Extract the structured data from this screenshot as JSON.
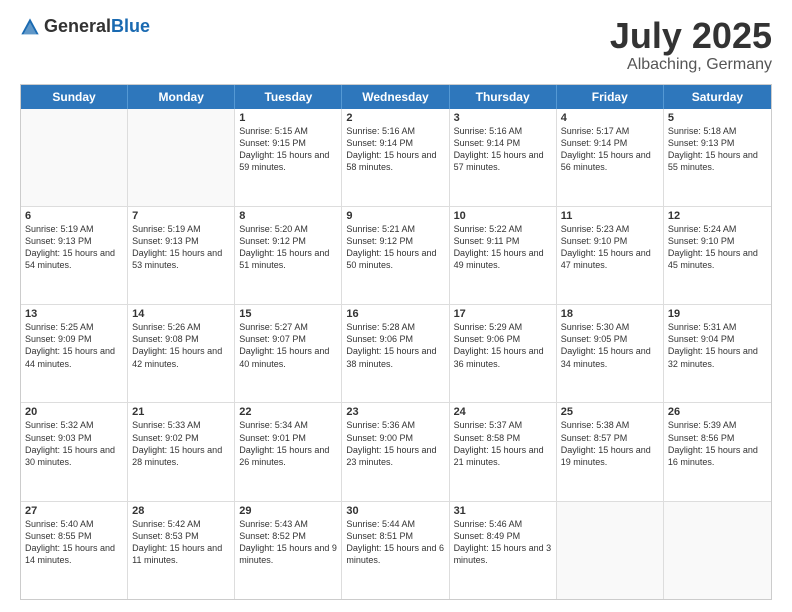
{
  "header": {
    "logo_general": "General",
    "logo_blue": "Blue",
    "month": "July 2025",
    "location": "Albaching, Germany"
  },
  "days_of_week": [
    "Sunday",
    "Monday",
    "Tuesday",
    "Wednesday",
    "Thursday",
    "Friday",
    "Saturday"
  ],
  "weeks": [
    [
      {
        "day": "",
        "sunrise": "",
        "sunset": "",
        "daylight": ""
      },
      {
        "day": "",
        "sunrise": "",
        "sunset": "",
        "daylight": ""
      },
      {
        "day": "1",
        "sunrise": "Sunrise: 5:15 AM",
        "sunset": "Sunset: 9:15 PM",
        "daylight": "Daylight: 15 hours and 59 minutes."
      },
      {
        "day": "2",
        "sunrise": "Sunrise: 5:16 AM",
        "sunset": "Sunset: 9:14 PM",
        "daylight": "Daylight: 15 hours and 58 minutes."
      },
      {
        "day": "3",
        "sunrise": "Sunrise: 5:16 AM",
        "sunset": "Sunset: 9:14 PM",
        "daylight": "Daylight: 15 hours and 57 minutes."
      },
      {
        "day": "4",
        "sunrise": "Sunrise: 5:17 AM",
        "sunset": "Sunset: 9:14 PM",
        "daylight": "Daylight: 15 hours and 56 minutes."
      },
      {
        "day": "5",
        "sunrise": "Sunrise: 5:18 AM",
        "sunset": "Sunset: 9:13 PM",
        "daylight": "Daylight: 15 hours and 55 minutes."
      }
    ],
    [
      {
        "day": "6",
        "sunrise": "Sunrise: 5:19 AM",
        "sunset": "Sunset: 9:13 PM",
        "daylight": "Daylight: 15 hours and 54 minutes."
      },
      {
        "day": "7",
        "sunrise": "Sunrise: 5:19 AM",
        "sunset": "Sunset: 9:13 PM",
        "daylight": "Daylight: 15 hours and 53 minutes."
      },
      {
        "day": "8",
        "sunrise": "Sunrise: 5:20 AM",
        "sunset": "Sunset: 9:12 PM",
        "daylight": "Daylight: 15 hours and 51 minutes."
      },
      {
        "day": "9",
        "sunrise": "Sunrise: 5:21 AM",
        "sunset": "Sunset: 9:12 PM",
        "daylight": "Daylight: 15 hours and 50 minutes."
      },
      {
        "day": "10",
        "sunrise": "Sunrise: 5:22 AM",
        "sunset": "Sunset: 9:11 PM",
        "daylight": "Daylight: 15 hours and 49 minutes."
      },
      {
        "day": "11",
        "sunrise": "Sunrise: 5:23 AM",
        "sunset": "Sunset: 9:10 PM",
        "daylight": "Daylight: 15 hours and 47 minutes."
      },
      {
        "day": "12",
        "sunrise": "Sunrise: 5:24 AM",
        "sunset": "Sunset: 9:10 PM",
        "daylight": "Daylight: 15 hours and 45 minutes."
      }
    ],
    [
      {
        "day": "13",
        "sunrise": "Sunrise: 5:25 AM",
        "sunset": "Sunset: 9:09 PM",
        "daylight": "Daylight: 15 hours and 44 minutes."
      },
      {
        "day": "14",
        "sunrise": "Sunrise: 5:26 AM",
        "sunset": "Sunset: 9:08 PM",
        "daylight": "Daylight: 15 hours and 42 minutes."
      },
      {
        "day": "15",
        "sunrise": "Sunrise: 5:27 AM",
        "sunset": "Sunset: 9:07 PM",
        "daylight": "Daylight: 15 hours and 40 minutes."
      },
      {
        "day": "16",
        "sunrise": "Sunrise: 5:28 AM",
        "sunset": "Sunset: 9:06 PM",
        "daylight": "Daylight: 15 hours and 38 minutes."
      },
      {
        "day": "17",
        "sunrise": "Sunrise: 5:29 AM",
        "sunset": "Sunset: 9:06 PM",
        "daylight": "Daylight: 15 hours and 36 minutes."
      },
      {
        "day": "18",
        "sunrise": "Sunrise: 5:30 AM",
        "sunset": "Sunset: 9:05 PM",
        "daylight": "Daylight: 15 hours and 34 minutes."
      },
      {
        "day": "19",
        "sunrise": "Sunrise: 5:31 AM",
        "sunset": "Sunset: 9:04 PM",
        "daylight": "Daylight: 15 hours and 32 minutes."
      }
    ],
    [
      {
        "day": "20",
        "sunrise": "Sunrise: 5:32 AM",
        "sunset": "Sunset: 9:03 PM",
        "daylight": "Daylight: 15 hours and 30 minutes."
      },
      {
        "day": "21",
        "sunrise": "Sunrise: 5:33 AM",
        "sunset": "Sunset: 9:02 PM",
        "daylight": "Daylight: 15 hours and 28 minutes."
      },
      {
        "day": "22",
        "sunrise": "Sunrise: 5:34 AM",
        "sunset": "Sunset: 9:01 PM",
        "daylight": "Daylight: 15 hours and 26 minutes."
      },
      {
        "day": "23",
        "sunrise": "Sunrise: 5:36 AM",
        "sunset": "Sunset: 9:00 PM",
        "daylight": "Daylight: 15 hours and 23 minutes."
      },
      {
        "day": "24",
        "sunrise": "Sunrise: 5:37 AM",
        "sunset": "Sunset: 8:58 PM",
        "daylight": "Daylight: 15 hours and 21 minutes."
      },
      {
        "day": "25",
        "sunrise": "Sunrise: 5:38 AM",
        "sunset": "Sunset: 8:57 PM",
        "daylight": "Daylight: 15 hours and 19 minutes."
      },
      {
        "day": "26",
        "sunrise": "Sunrise: 5:39 AM",
        "sunset": "Sunset: 8:56 PM",
        "daylight": "Daylight: 15 hours and 16 minutes."
      }
    ],
    [
      {
        "day": "27",
        "sunrise": "Sunrise: 5:40 AM",
        "sunset": "Sunset: 8:55 PM",
        "daylight": "Daylight: 15 hours and 14 minutes."
      },
      {
        "day": "28",
        "sunrise": "Sunrise: 5:42 AM",
        "sunset": "Sunset: 8:53 PM",
        "daylight": "Daylight: 15 hours and 11 minutes."
      },
      {
        "day": "29",
        "sunrise": "Sunrise: 5:43 AM",
        "sunset": "Sunset: 8:52 PM",
        "daylight": "Daylight: 15 hours and 9 minutes."
      },
      {
        "day": "30",
        "sunrise": "Sunrise: 5:44 AM",
        "sunset": "Sunset: 8:51 PM",
        "daylight": "Daylight: 15 hours and 6 minutes."
      },
      {
        "day": "31",
        "sunrise": "Sunrise: 5:46 AM",
        "sunset": "Sunset: 8:49 PM",
        "daylight": "Daylight: 15 hours and 3 minutes."
      },
      {
        "day": "",
        "sunrise": "",
        "sunset": "",
        "daylight": ""
      },
      {
        "day": "",
        "sunrise": "",
        "sunset": "",
        "daylight": ""
      }
    ]
  ]
}
